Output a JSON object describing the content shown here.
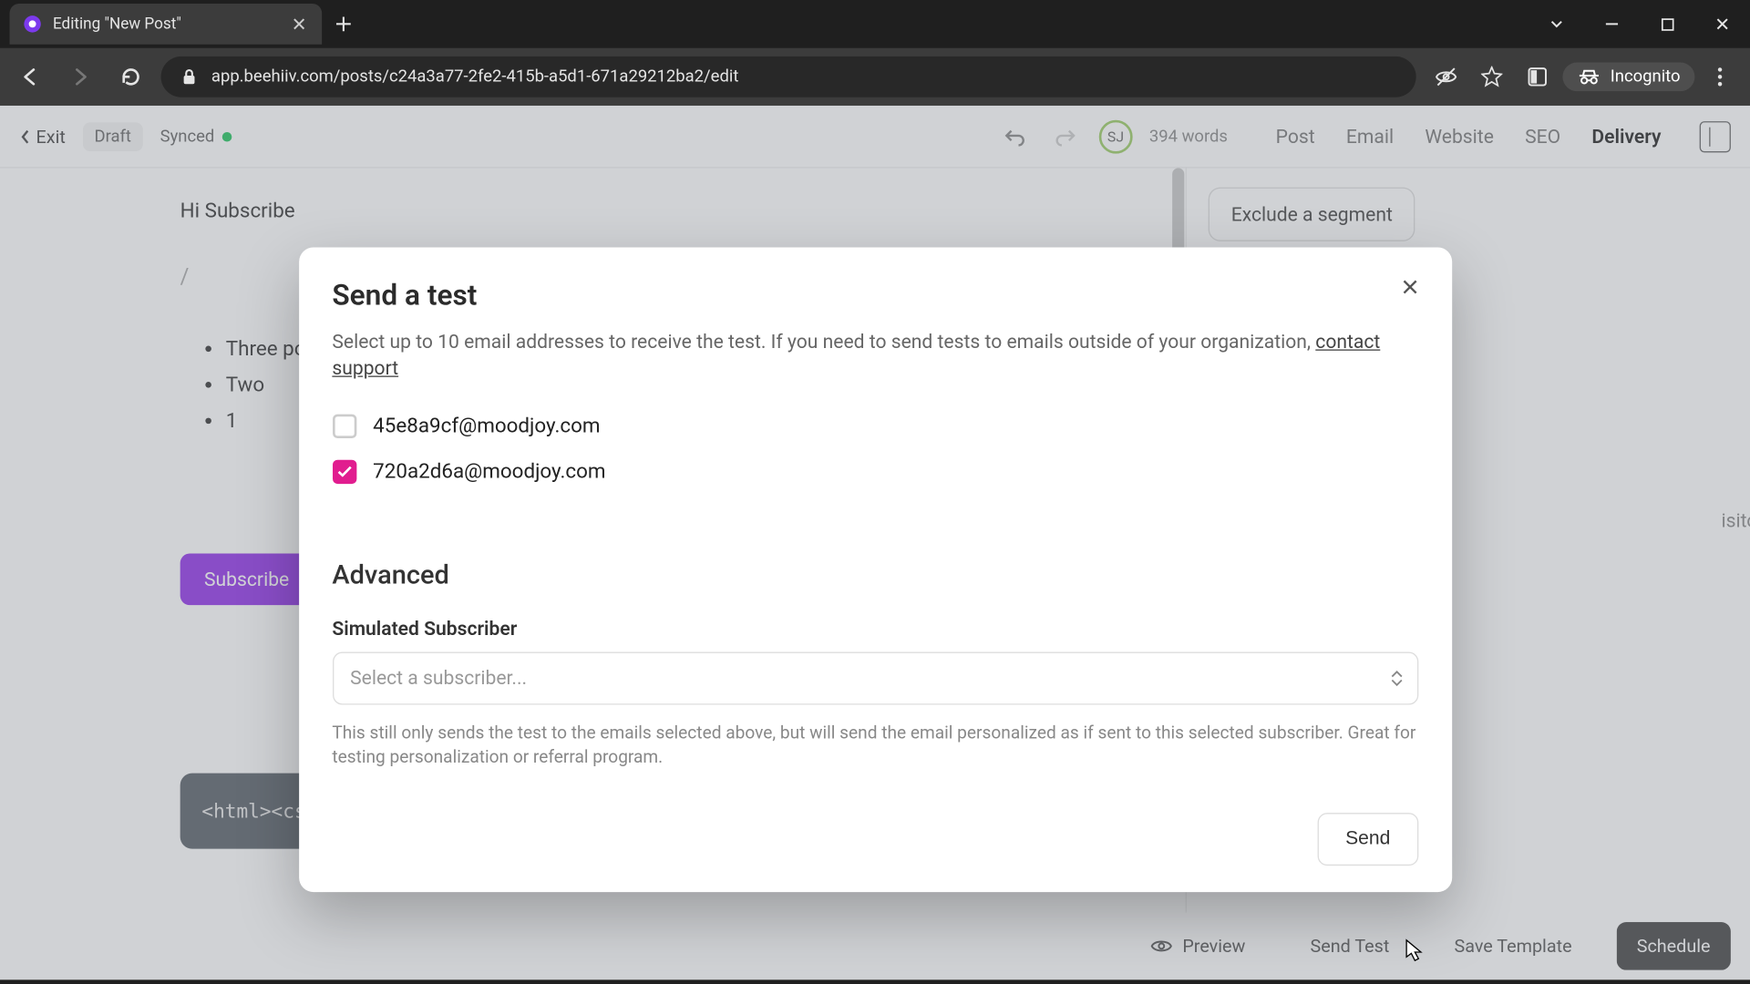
{
  "browser": {
    "tab_title": "Editing \"New Post\"",
    "incognito_label": "Incognito",
    "url": "app.beehiiv.com/posts/c24a3a77-2fe2-415b-a5d1-671a29212ba2/edit"
  },
  "toolbar": {
    "exit_label": "Exit",
    "draft_label": "Draft",
    "synced_label": "Synced",
    "avatar_initials": "SJ",
    "word_count": "394 words",
    "tabs": {
      "post": "Post",
      "email": "Email",
      "website": "Website",
      "seo": "SEO",
      "delivery": "Delivery"
    }
  },
  "document": {
    "greeting": "Hi Subscribe",
    "slash": "/",
    "bullets": [
      "Three po",
      "Two",
      "1"
    ],
    "subscribe_btn": "Subscribe",
    "code_block": "<html><css>"
  },
  "side_panel": {
    "exclude_segment": "Exclude a segment",
    "ghost_text": "isitors"
  },
  "modal": {
    "title": "Send a test",
    "description_prefix": "Select up to 10 email addresses to receive the test. If you need to send tests to emails outside of your organization, ",
    "description_link": "contact support",
    "emails": [
      {
        "label": "45e8a9cf@moodjoy.com",
        "checked": false
      },
      {
        "label": "720a2d6a@moodjoy.com",
        "checked": true
      }
    ],
    "advanced_title": "Advanced",
    "simulated_label": "Simulated Subscriber",
    "select_placeholder": "Select a subscriber...",
    "hint": "This still only sends the test to the emails selected above, but will send the email personalized as if sent to this selected subscriber. Great for testing personalization or referral program.",
    "send_btn": "Send"
  },
  "footer": {
    "preview": "Preview",
    "send_test": "Send Test",
    "save_template": "Save Template",
    "schedule": "Schedule"
  }
}
